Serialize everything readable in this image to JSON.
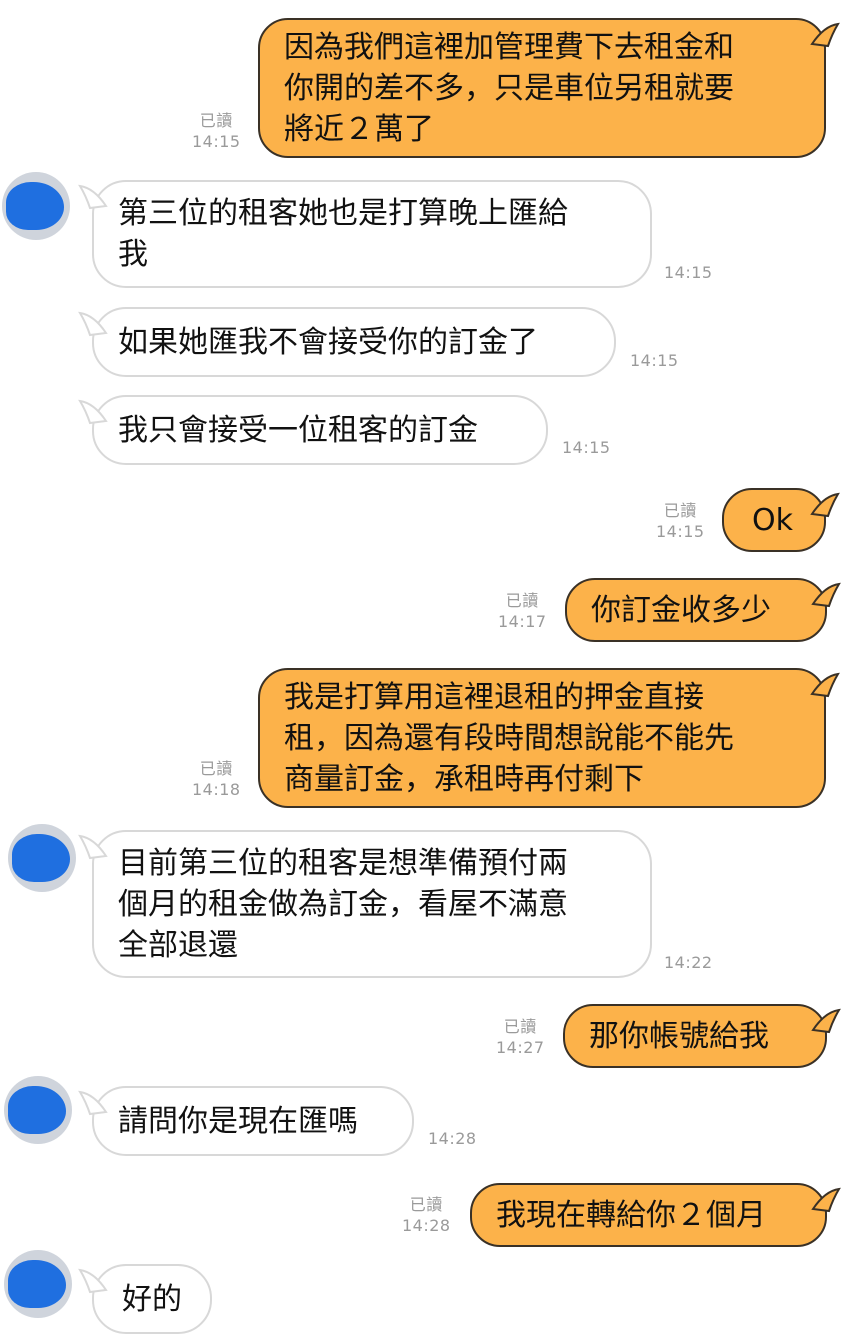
{
  "conversation": {
    "read_label": "已讀",
    "colors": {
      "outgoing_bubble": "#fcb24a",
      "incoming_bubble": "#ffffff",
      "avatar_scribble": "#1f6fe0",
      "timestamp": "#9a9a9a"
    },
    "messages": [
      {
        "sender": "me",
        "lines": [
          "因為我們這裡加管理費下去租金和",
          "你開的差不多，只是車位另租就要",
          "將近２萬了"
        ],
        "time": "14:15",
        "read": true
      },
      {
        "sender": "landlord",
        "lines": [
          "第三位的租客她也是打算晚上匯給",
          "我"
        ],
        "time": "14:15"
      },
      {
        "sender": "landlord",
        "lines": [
          "如果她匯我不會接受你的訂金了"
        ],
        "time": "14:15"
      },
      {
        "sender": "landlord",
        "lines": [
          "我只會接受一位租客的訂金"
        ],
        "time": "14:15"
      },
      {
        "sender": "me",
        "lines": [
          "Ok"
        ],
        "time": "14:15",
        "read": true
      },
      {
        "sender": "me",
        "lines": [
          "你訂金收多少"
        ],
        "time": "14:17",
        "read": true
      },
      {
        "sender": "me",
        "lines": [
          "我是打算用這裡退租的押金直接",
          "租，因為還有段時間想說能不能先",
          "商量訂金，承租時再付剩下"
        ],
        "time": "14:18",
        "read": true
      },
      {
        "sender": "landlord",
        "lines": [
          "目前第三位的租客是想準備預付兩",
          "個月的租金做為訂金，看屋不滿意",
          "全部退還"
        ],
        "time": "14:22"
      },
      {
        "sender": "me",
        "lines": [
          "那你帳號給我"
        ],
        "time": "14:27",
        "read": true
      },
      {
        "sender": "landlord",
        "lines": [
          "請問你是現在匯嗎"
        ],
        "time": "14:28"
      },
      {
        "sender": "me",
        "lines": [
          "我現在轉給你２個月"
        ],
        "time": "14:28",
        "read": true
      },
      {
        "sender": "landlord",
        "lines": [
          "好的"
        ],
        "time": ""
      }
    ]
  }
}
